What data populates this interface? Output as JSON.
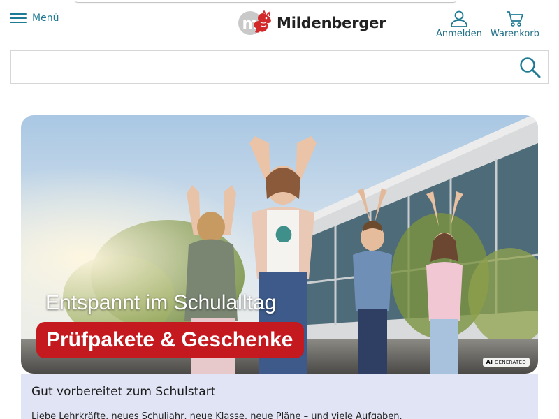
{
  "header": {
    "menu_label": "Menü",
    "logo_text": "Mildenberger",
    "login_label": "Anmelden",
    "cart_label": "Warenkorb"
  },
  "search": {
    "placeholder": "",
    "value": ""
  },
  "hero": {
    "title": "Entspannt im Schulalltag",
    "highlight": "Prüfpakete & Geschenke",
    "badge_ai": "AI",
    "badge_generated": "GENERATED",
    "pill_color": "#c4191e"
  },
  "info": {
    "heading": "Gut vorbereitet zum Schulstart",
    "text": "Liebe Lehrkräfte, neues Schuljahr, neue Klasse, neue Pläne – und viele Aufgaben."
  },
  "colors": {
    "accent": "#1f7a94",
    "brand_red": "#c4191e",
    "info_bg": "#e1e4f4"
  },
  "icons": [
    "hamburger-menu-icon",
    "user-icon",
    "shopping-cart-icon",
    "search-icon",
    "logo-dragon-icon"
  ]
}
